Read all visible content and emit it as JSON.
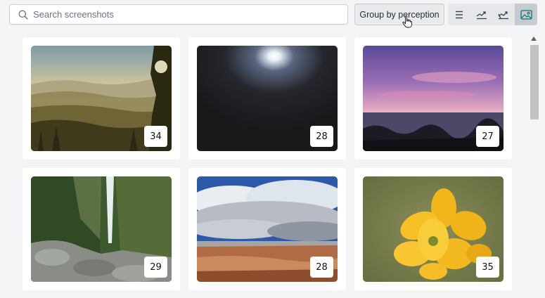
{
  "search": {
    "placeholder": "Search screenshots",
    "value": ""
  },
  "group_button": {
    "label": "Group by perception"
  },
  "view_modes": [
    {
      "name": "list",
      "icon": "list-icon",
      "active": false
    },
    {
      "name": "trend-up",
      "icon": "trend-up-icon",
      "active": false
    },
    {
      "name": "trend-down",
      "icon": "trend-down-icon",
      "active": false
    },
    {
      "name": "gallery",
      "icon": "image-icon",
      "active": true
    }
  ],
  "images": [
    {
      "scene": "misty-hills",
      "score": "34"
    },
    {
      "scene": "night-moon",
      "score": "28"
    },
    {
      "scene": "sunset-coast",
      "score": "27"
    },
    {
      "scene": "waterfall-gorge",
      "score": "29"
    },
    {
      "scene": "desert-clouds",
      "score": "28"
    },
    {
      "scene": "yellow-flower",
      "score": "35"
    }
  ],
  "colors": {
    "accent": "#0f766e",
    "background": "#f3f4f6"
  }
}
